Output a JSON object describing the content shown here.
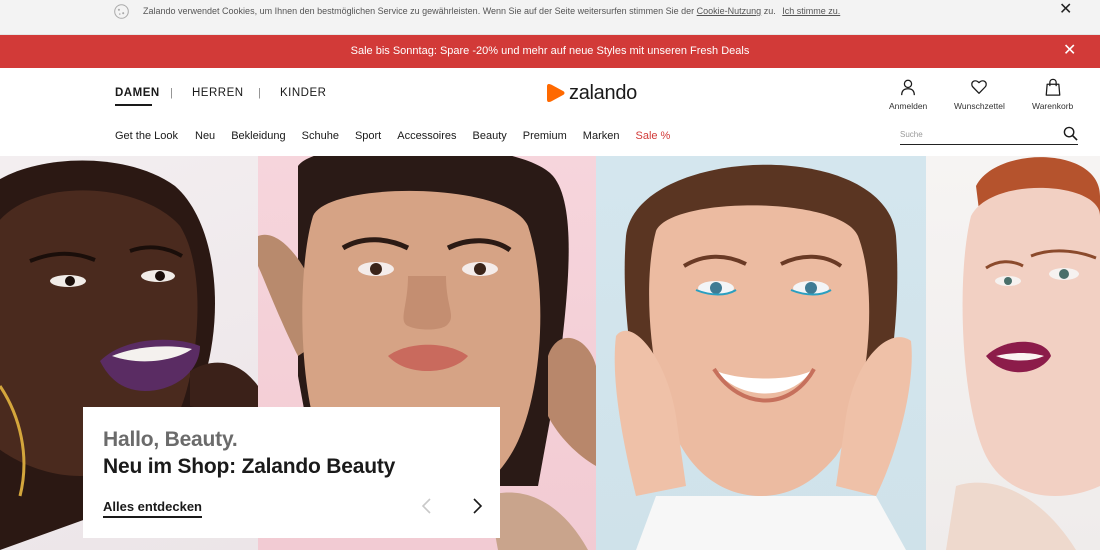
{
  "cookie": {
    "text": "Zalando verwendet Cookies, um Ihnen den bestmöglichen Service zu gewährleisten. Wenn Sie auf der Seite weitersurfen stimmen Sie der ",
    "link_label": "Cookie-Nutzung",
    "after_link": " zu.",
    "accept_label": "Ich stimme zu.",
    "close_glyph": "✕"
  },
  "banner": {
    "text": "Sale bis Sonntag: Spare -20% und mehr auf neue Styles mit unseren Fresh Deals",
    "close_glyph": "✕",
    "color": "#d23a38"
  },
  "gender_nav": {
    "items": [
      "DAMEN",
      "HERREN",
      "KINDER"
    ],
    "active": "DAMEN",
    "separator": "|"
  },
  "logo": {
    "text": "zalando",
    "color": "#ff6900"
  },
  "actions": [
    {
      "label": "Anmelden",
      "icon": "user-icon"
    },
    {
      "label": "Wunschzettel",
      "icon": "heart-icon"
    },
    {
      "label": "Warenkorb",
      "icon": "bag-icon"
    }
  ],
  "categories": [
    "Get the Look",
    "Neu",
    "Bekleidung",
    "Schuhe",
    "Sport",
    "Accessoires",
    "Beauty",
    "Premium",
    "Marken",
    "Sale %"
  ],
  "search": {
    "placeholder": "Suche",
    "icon": "search-icon"
  },
  "hero": {
    "title": "Hallo, Beauty.",
    "subtitle": "Neu im Shop: Zalando Beauty",
    "cta": "Alles entdecken",
    "prev_icon": "chevron-left-icon",
    "next_icon": "chevron-right-icon"
  }
}
